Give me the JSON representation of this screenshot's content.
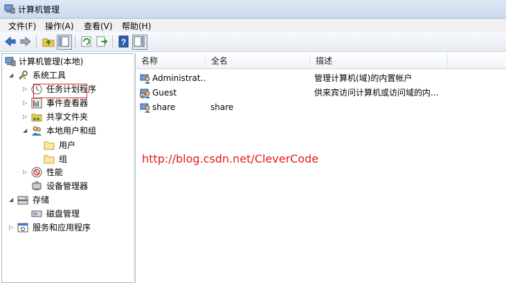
{
  "window": {
    "title": "计算机管理"
  },
  "menu": [
    "文件(F)",
    "操作(A)",
    "查看(V)",
    "帮助(H)"
  ],
  "toolbar": {
    "icons": [
      "back-arrow-icon",
      "forward-arrow-icon",
      "up-folder-icon",
      "show-hide-tree-icon",
      "refresh-icon",
      "export-list-icon",
      "help-icon",
      "action-pane-icon"
    ]
  },
  "tree": {
    "root": "计算机管理(本地)",
    "items": [
      {
        "label": "系统工具"
      },
      {
        "label": "任务计划程序"
      },
      {
        "label": "事件查看器"
      },
      {
        "label": "共享文件夹"
      },
      {
        "label": "本地用户和组"
      },
      {
        "label": "用户"
      },
      {
        "label": "组"
      },
      {
        "label": "性能"
      },
      {
        "label": "设备管理器"
      },
      {
        "label": "存储"
      },
      {
        "label": "磁盘管理"
      },
      {
        "label": "服务和应用程序"
      }
    ]
  },
  "list": {
    "columns": [
      "名称",
      "全名",
      "描述"
    ],
    "rows": [
      {
        "name": "Administrat...",
        "fullname": "",
        "desc": "管理计算机(域)的内置帐户"
      },
      {
        "name": "Guest",
        "fullname": "",
        "desc": "供来宾访问计算机或访问域的内..."
      },
      {
        "name": "share",
        "fullname": "share",
        "desc": ""
      }
    ]
  },
  "watermark": "http://blog.csdn.net/CleverCode",
  "colors": {
    "accent": "#3a78c8",
    "watermark": "#e81818",
    "selection_border": "#e02020"
  }
}
